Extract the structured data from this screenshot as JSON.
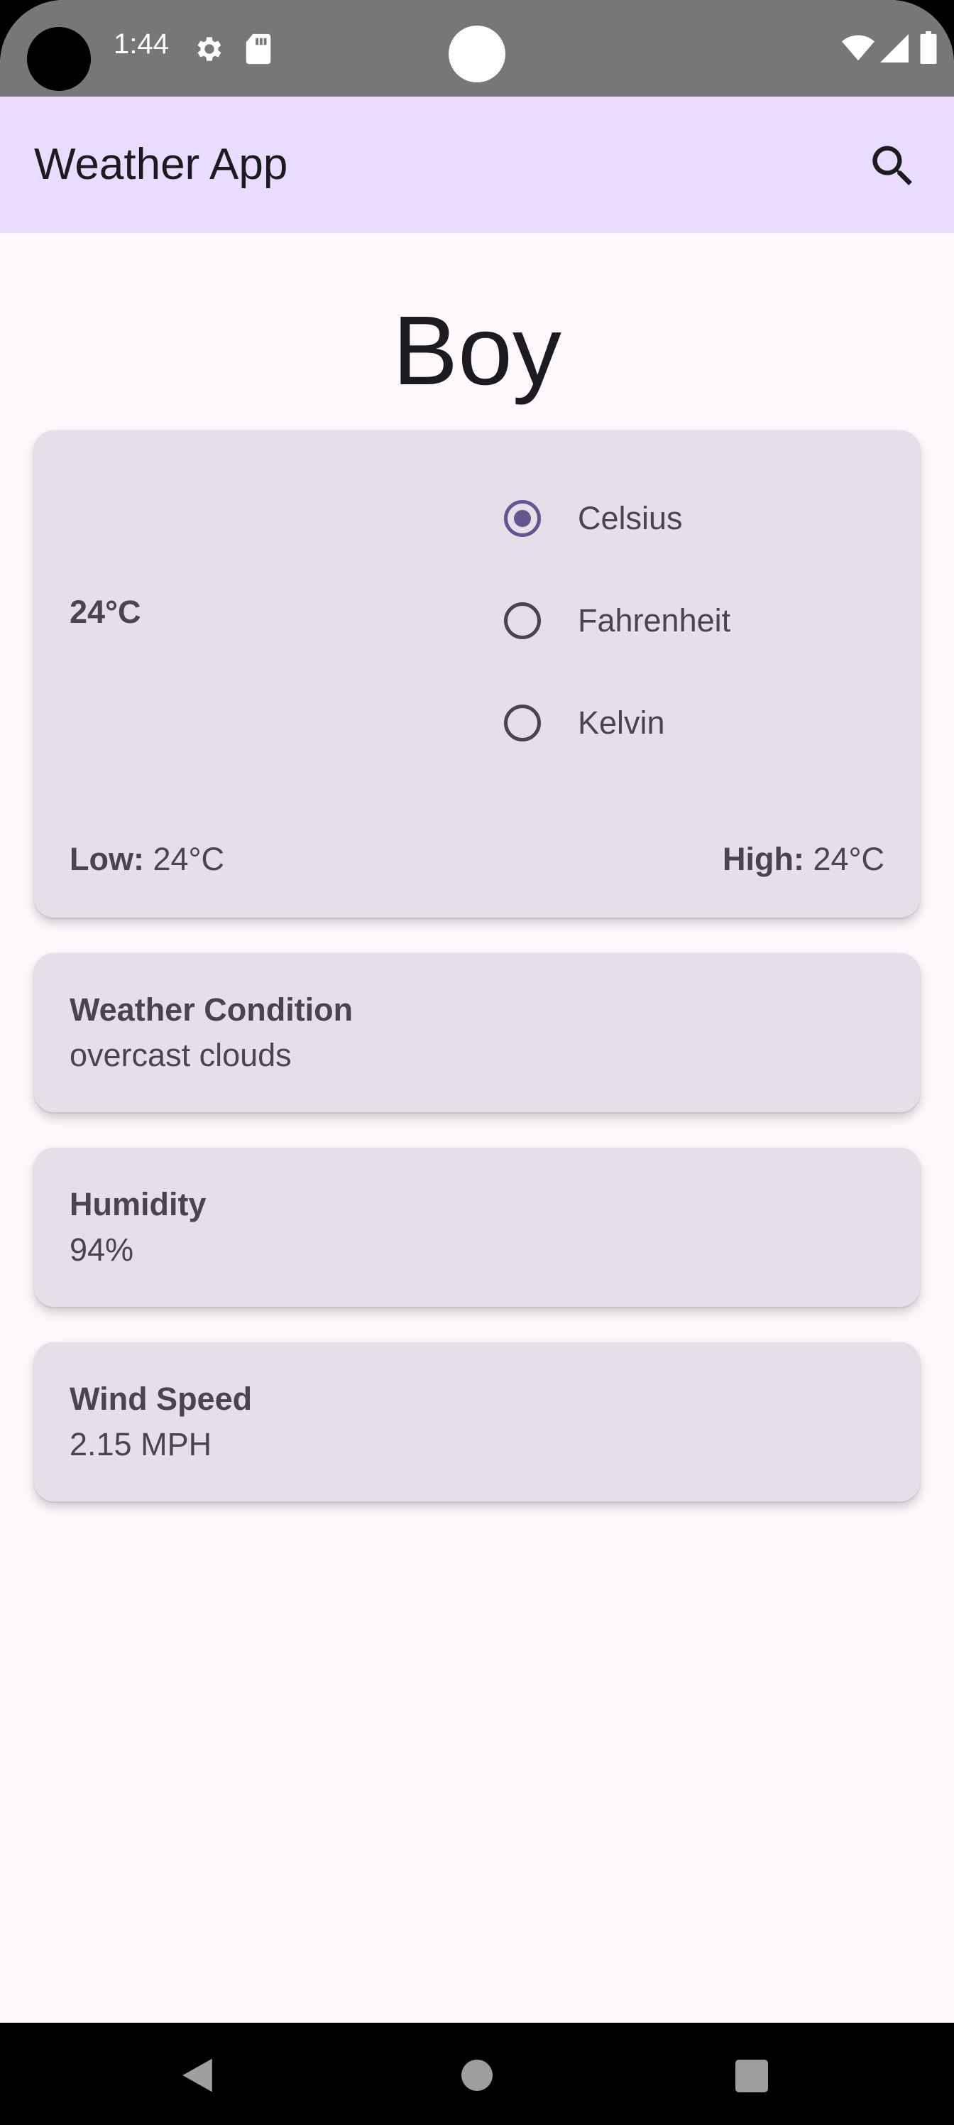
{
  "status_bar": {
    "time": "1:44",
    "icons": [
      "camera-hole",
      "gear-icon",
      "sd-card-icon",
      "wifi-icon",
      "signal-icon",
      "battery-icon"
    ]
  },
  "app_bar": {
    "title": "Weather App",
    "search_icon": "search-icon"
  },
  "city": "Boy",
  "temperature_card": {
    "current": "24°C",
    "units": [
      {
        "label": "Celsius",
        "selected": true
      },
      {
        "label": "Fahrenheit",
        "selected": false
      },
      {
        "label": "Kelvin",
        "selected": false
      }
    ],
    "low_label": "Low:",
    "low_value": "24°C",
    "high_label": "High:",
    "high_value": "24°C"
  },
  "condition_card": {
    "title": "Weather Condition",
    "value": "overcast clouds"
  },
  "humidity_card": {
    "title": "Humidity",
    "value": "94%"
  },
  "wind_card": {
    "title": "Wind Speed",
    "value": "2.15 MPH"
  },
  "nav_bar": {
    "icons": [
      "back-icon",
      "home-icon",
      "recents-icon"
    ]
  },
  "colors": {
    "accent": "#65558f",
    "app_bar": "#eadcff",
    "card": "#e6dfea",
    "background": "#fef7fc",
    "status_bar": "#777777"
  }
}
